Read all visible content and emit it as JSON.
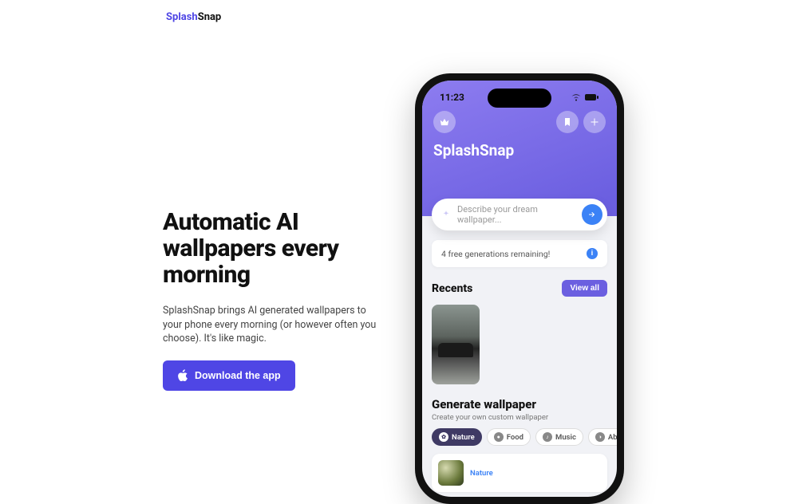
{
  "brand": {
    "left": "Splash",
    "right": "Snap"
  },
  "hero": {
    "title": "Automatic AI wallpapers every morning",
    "subtitle": "SplashSnap brings AI generated wallpapers to your phone every morning (or however often you choose). It's like magic.",
    "cta": "Download the app"
  },
  "phone": {
    "status": {
      "time": "11:23"
    },
    "app_title": "SplashSnap",
    "search": {
      "placeholder": "Describe your dream wallpaper..."
    },
    "notice": "4 free generations remaining!",
    "recents": {
      "heading": "Recents",
      "viewall": "View all"
    },
    "generate": {
      "heading": "Generate wallpaper",
      "subheading": "Create your own custom wallpaper",
      "chips": [
        {
          "label": "Nature",
          "active": true
        },
        {
          "label": "Food",
          "active": false
        },
        {
          "label": "Music",
          "active": false
        },
        {
          "label": "Abstract",
          "active": false
        }
      ],
      "preview_label": "Nature"
    }
  }
}
